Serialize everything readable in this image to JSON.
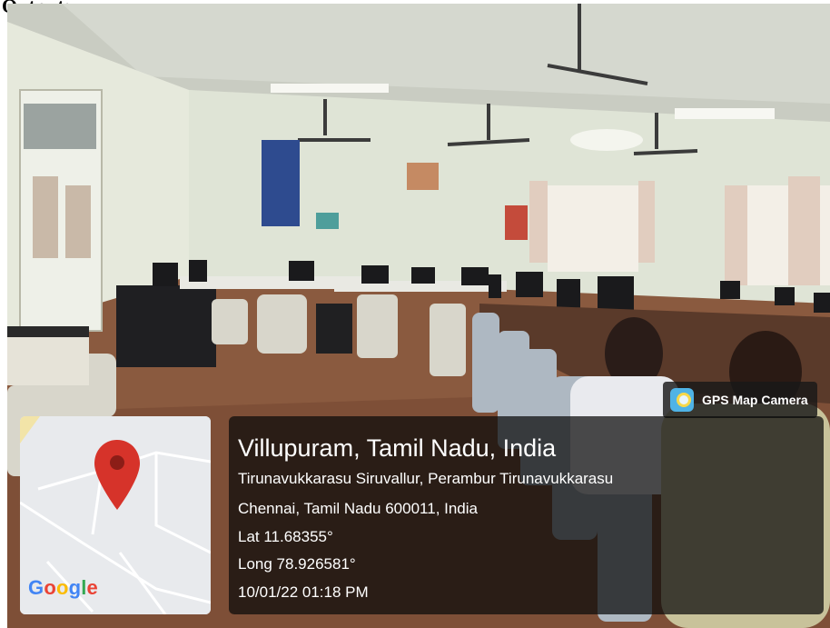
{
  "heading": "Output:",
  "badge": {
    "icon": "gps-map-camera-icon",
    "label": "GPS Map Camera"
  },
  "location": {
    "title": "Villupuram, Tamil Nadu, India",
    "address_line1": "Tirunavukkarasu Siruvallur, Perambur Tirunavukkarasu",
    "address_line2": "Chennai, Tamil Nadu 600011, India",
    "lat": "Lat 11.68355°",
    "long": "Long 78.926581°",
    "datetime": "10/01/22 01:18 PM"
  },
  "map": {
    "logo_letters": [
      "G",
      "o",
      "o",
      "g",
      "l",
      "e"
    ],
    "logo_colors": [
      "#4285F4",
      "#EA4335",
      "#FBBC05",
      "#4285F4",
      "#34A853",
      "#EA4335"
    ],
    "pin_color": "#d6332a"
  }
}
